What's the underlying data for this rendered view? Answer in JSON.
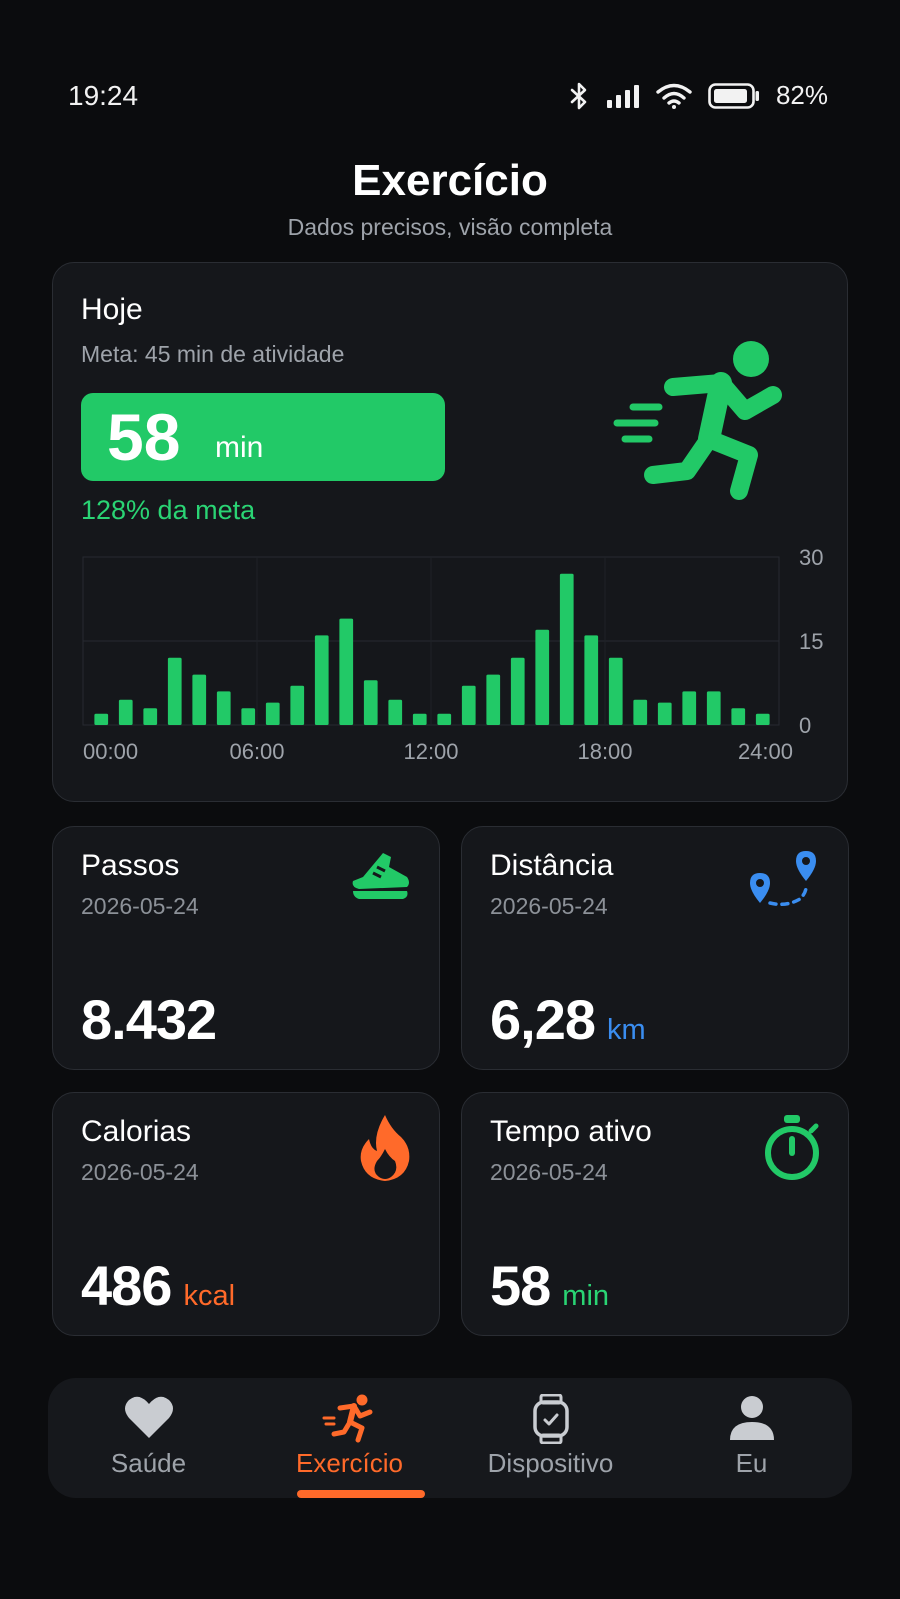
{
  "status_bar": {
    "time": "19:24",
    "battery_percent": "82%",
    "icons": [
      "bluetooth-icon",
      "signal-icon",
      "wifi-icon",
      "battery-icon"
    ]
  },
  "header": {
    "title": "Exercício",
    "subtitle": "Dados precisos, visão completa"
  },
  "today": {
    "title": "Hoje",
    "goal": "Meta: 45 min de atividade",
    "value": "58",
    "unit": "min",
    "percent_text": "128% da meta",
    "icon": "running-icon"
  },
  "chart_data": {
    "type": "bar",
    "x_tick_labels": [
      "00:00",
      "06:00",
      "12:00",
      "18:00",
      "24:00"
    ],
    "y_tick_labels": [
      "30",
      "15",
      "0"
    ],
    "ylim": [
      0,
      30
    ],
    "grid": true,
    "values": [
      2,
      4.5,
      3,
      12,
      9,
      6,
      3,
      4,
      7,
      16,
      19,
      8,
      4.5,
      2,
      2,
      7,
      9,
      12,
      17,
      27,
      16,
      12,
      4.5,
      4,
      6,
      6,
      3,
      2
    ],
    "bar_color": "#22c967"
  },
  "stats": [
    {
      "title": "Passos",
      "date": "2026-05-24",
      "value": "8.432",
      "unit": "",
      "icon": "sneaker-icon",
      "accent": "#2ad474"
    },
    {
      "title": "Distância",
      "date": "2026-05-24",
      "value": "6,28",
      "unit": "km",
      "icon": "route-pins-icon",
      "accent": "#3a8df0"
    },
    {
      "title": "Calorias",
      "date": "2026-05-24",
      "value": "486",
      "unit": "kcal",
      "icon": "flame-icon",
      "accent": "#ff6a2a"
    },
    {
      "title": "Tempo ativo",
      "date": "2026-05-24",
      "value": "58",
      "unit": "min",
      "icon": "stopwatch-icon",
      "accent": "#2ad474"
    }
  ],
  "bottom_nav": {
    "items": [
      {
        "label": "Saúde",
        "icon": "heart-icon",
        "active": false
      },
      {
        "label": "Exercício",
        "icon": "running-icon",
        "active": true
      },
      {
        "label": "Dispositivo",
        "icon": "watch-icon",
        "active": false
      },
      {
        "label": "Eu",
        "icon": "user-icon",
        "active": false
      }
    ]
  },
  "colors": {
    "background": "#0b0c0e",
    "card": "#15171b",
    "green": "#22c967",
    "blue": "#3a8df0",
    "orange": "#ff6a2a"
  }
}
